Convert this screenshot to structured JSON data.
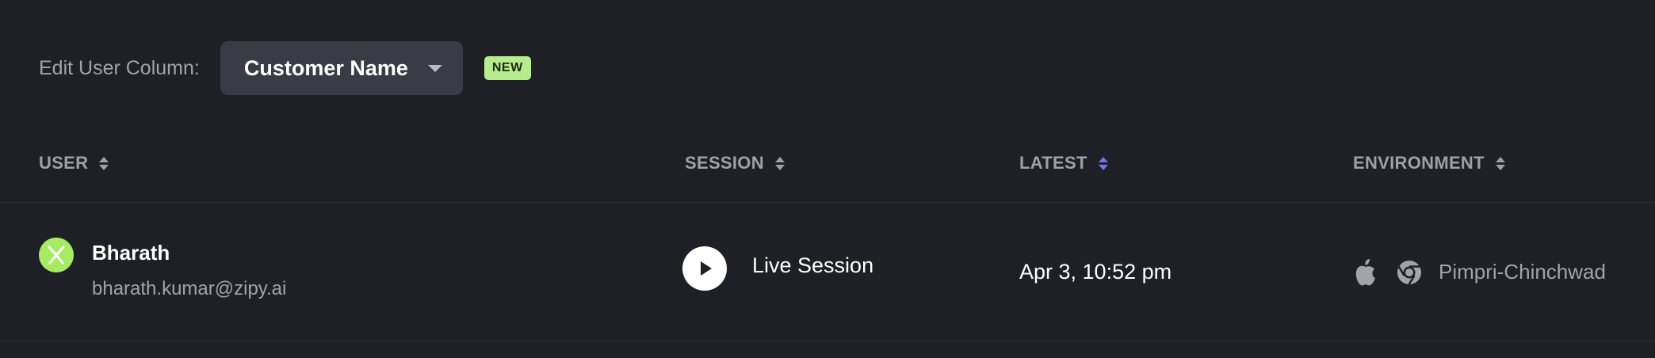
{
  "toolbar": {
    "label": "Edit User Column:",
    "selected_column": "Customer Name",
    "badge": "NEW"
  },
  "table": {
    "columns": [
      {
        "label": "USER",
        "sort_active": false
      },
      {
        "label": "SESSION",
        "sort_active": false
      },
      {
        "label": "LATEST",
        "sort_active": true
      },
      {
        "label": "ENVIRONMENT",
        "sort_active": false
      }
    ],
    "rows": [
      {
        "user_name": "Bharath",
        "user_email": "bharath.kumar@zipy.ai",
        "session_label": "Live Session",
        "latest": "Apr 3, 10:52 pm",
        "os_icon": "apple-icon",
        "browser_icon": "chrome-icon",
        "location": "Pimpri-Chinchwad"
      }
    ]
  },
  "colors": {
    "background": "#1f2025",
    "select_bg": "#3a3b45",
    "badge_bg": "#b6ec8e",
    "avatar_bg": "#a6ec63",
    "sort_active": "#6f74e8",
    "muted_text": "#a2a3ab"
  }
}
